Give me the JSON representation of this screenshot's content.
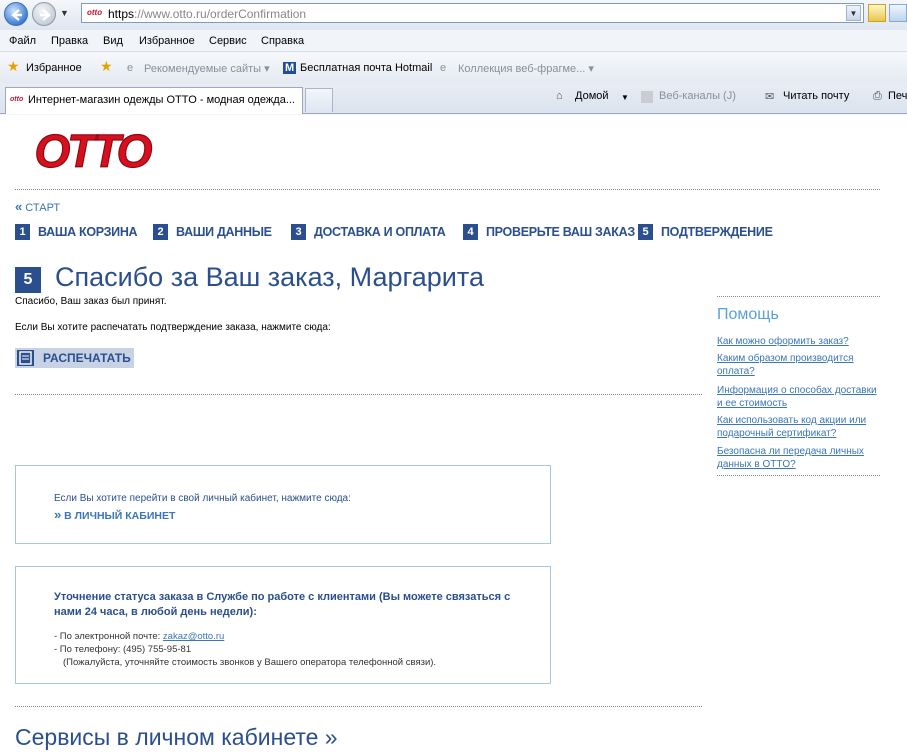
{
  "browser": {
    "url_scheme": "https",
    "url_host": "://www.otto.ru",
    "url_path": "/orderConfirmation",
    "favicon_text": "otto",
    "menu": [
      "Файл",
      "Правка",
      "Вид",
      "Избранное",
      "Сервис",
      "Справка"
    ],
    "favorites_label": "Избранное",
    "fav_items": [
      "Рекомендуемые сайты ▾",
      "Бесплатная почта Hotmail",
      "Коллекция веб-фрагме...  ▾"
    ],
    "tab_title": "Интернет-магазин одежды OTTO - модная одежда...",
    "home_label": "Домой",
    "feeds_label": "Веб-каналы (J)",
    "mail_label": "Читать почту",
    "print_label": "Печ"
  },
  "page": {
    "logo_text": "OTTO",
    "start_link": "СТАРТ",
    "steps": [
      {
        "num": "1",
        "label": "ВАША КОРЗИНА"
      },
      {
        "num": "2",
        "label": "ВАШИ ДАННЫЕ"
      },
      {
        "num": "3",
        "label": "ДОСТАВКА И ОПЛАТА"
      },
      {
        "num": "4",
        "label": "ПРОВЕРЬТЕ ВАШ ЗАКАЗ"
      },
      {
        "num": "5",
        "label": "ПОДТВЕРЖДЕНИЕ"
      }
    ],
    "current_step": "5",
    "thanks_title": "Спасибо за Ваш заказ, Маргарита",
    "order_accepted": "Спасибо, Ваш заказ был принят.",
    "print_hint": "Если Вы хотите распечатать подтверждение заказа, нажмите сюда:",
    "print_button": "РАСПЕЧАТАТЬ",
    "cabinet_hint": "Если Вы хотите перейти в свой личный кабинет, нажмите сюда:",
    "cabinet_link": "В ЛИЧНЫЙ КАБИНЕТ",
    "status_title": "Уточнение статуса заказа в Службе по работе с клиентами (Вы можете связаться с нами 24 часа, в любой день недели):",
    "email_prefix": "-  По электронной почте: ",
    "email": "zakaz@otto.ru",
    "phone_line": "-  По телефону: (495) 755-95-81",
    "phone_note": "(Пожалуйста, уточняйте стоимость звонков у Вашего оператора телефонной связи).",
    "services_title": "Сервисы в личном кабинете »"
  },
  "help": {
    "title": "Помощь",
    "links": [
      "Как можно оформить заказ?",
      "Каким образом производится оплата?",
      "Информация о способах доставки и ее стоимость",
      "Как использовать код акции или подарочный сертификат?",
      "Безопасна ли передача личных данных в OTTO?"
    ]
  },
  "colors": {
    "brand_red": "#d6101e",
    "brand_blue": "#2b4f8e",
    "link_blue": "#3a76b8",
    "box_border": "#a8c6dc"
  }
}
